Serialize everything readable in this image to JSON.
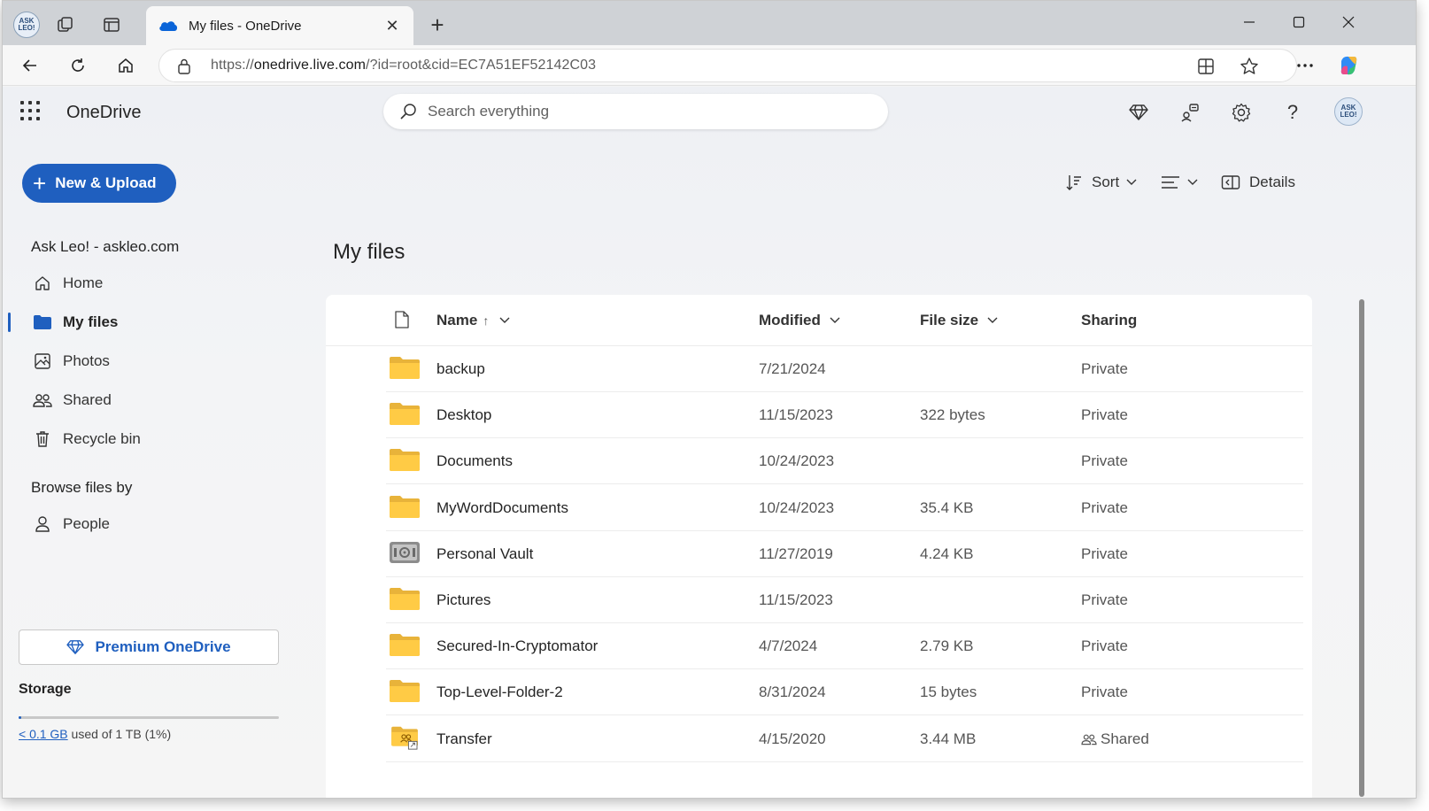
{
  "browser": {
    "tab_title": "My files - OneDrive",
    "profile_badge": "ASK LEO!",
    "url_prefix": "https://",
    "url_host": "onedrive.live.com",
    "url_path": "/?id=root&cid=EC7A51EF52142C03"
  },
  "app": {
    "name": "OneDrive",
    "search_placeholder": "Search everything",
    "avatar_text": "ASK LEO!",
    "accent_color": "#1f5fbf"
  },
  "sidebar": {
    "new_button": "New & Upload",
    "account_heading": "Ask Leo! - askleo.com",
    "items": [
      {
        "label": "Home",
        "icon": "home-icon"
      },
      {
        "label": "My files",
        "icon": "folder-icon",
        "active": true
      },
      {
        "label": "Photos",
        "icon": "photo-icon"
      },
      {
        "label": "Shared",
        "icon": "people-icon"
      },
      {
        "label": "Recycle bin",
        "icon": "trash-icon"
      }
    ],
    "browse_heading": "Browse files by",
    "browse_items": [
      {
        "label": "People",
        "icon": "person-icon"
      }
    ],
    "premium_button": "Premium OneDrive",
    "storage": {
      "label": "Storage",
      "used_link": "< 0.1 GB",
      "used_suffix": "used of 1 TB (1%)",
      "used_percent": 1
    }
  },
  "commands": {
    "sort": "Sort",
    "details": "Details"
  },
  "main": {
    "title": "My files",
    "columns": {
      "name": "Name",
      "name_sort_indicator": "↑",
      "modified": "Modified",
      "file_size": "File size",
      "sharing": "Sharing"
    },
    "files": [
      {
        "name": "backup",
        "modified": "7/21/2024",
        "size": "",
        "sharing": "Private",
        "type": "folder"
      },
      {
        "name": "Desktop",
        "modified": "11/15/2023",
        "size": "322 bytes",
        "sharing": "Private",
        "type": "folder"
      },
      {
        "name": "Documents",
        "modified": "10/24/2023",
        "size": "",
        "sharing": "Private",
        "type": "folder"
      },
      {
        "name": "MyWordDocuments",
        "modified": "10/24/2023",
        "size": "35.4 KB",
        "sharing": "Private",
        "type": "folder"
      },
      {
        "name": "Personal Vault",
        "modified": "11/27/2019",
        "size": "4.24 KB",
        "sharing": "Private",
        "type": "vault"
      },
      {
        "name": "Pictures",
        "modified": "11/15/2023",
        "size": "",
        "sharing": "Private",
        "type": "folder"
      },
      {
        "name": "Secured-In-Cryptomator",
        "modified": "4/7/2024",
        "size": "2.79 KB",
        "sharing": "Private",
        "type": "folder"
      },
      {
        "name": "Top-Level-Folder-2",
        "modified": "8/31/2024",
        "size": "15 bytes",
        "sharing": "Private",
        "type": "folder"
      },
      {
        "name": "Transfer",
        "modified": "4/15/2020",
        "size": "3.44 MB",
        "sharing": "Shared",
        "type": "shared-folder"
      }
    ]
  }
}
